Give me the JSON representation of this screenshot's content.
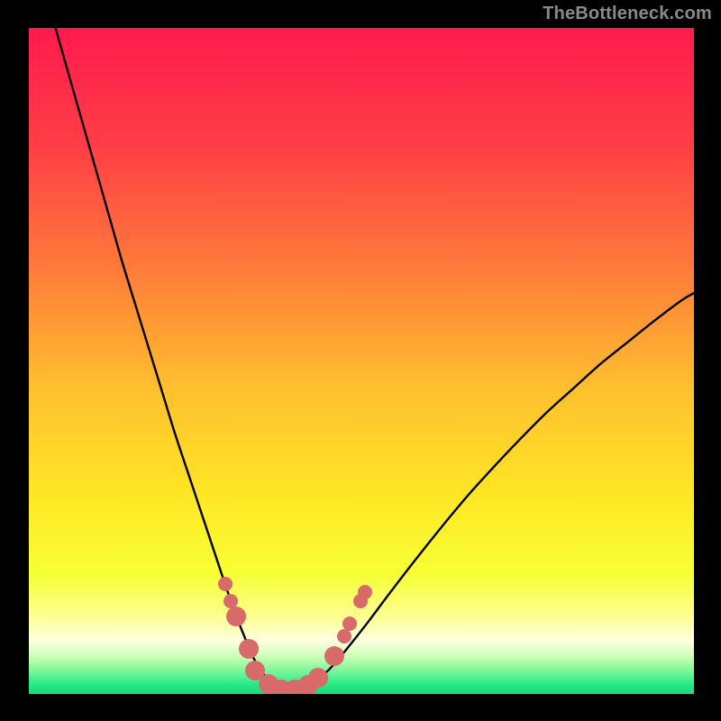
{
  "watermark": {
    "text": "TheBottleneck.com"
  },
  "chart_data": {
    "type": "line",
    "title": "",
    "xlabel": "",
    "ylabel": "",
    "xlim": [
      0,
      100
    ],
    "ylim": [
      0,
      100
    ],
    "grid": false,
    "legend": false,
    "background_gradient": {
      "orientation": "vertical",
      "stops": [
        {
          "pos": 0.0,
          "color": "#ff1a4e"
        },
        {
          "pos": 0.18,
          "color": "#ff3f46"
        },
        {
          "pos": 0.36,
          "color": "#ff7a3a"
        },
        {
          "pos": 0.54,
          "color": "#ffbf2e"
        },
        {
          "pos": 0.7,
          "color": "#ffe625"
        },
        {
          "pos": 0.82,
          "color": "#f6ff35"
        },
        {
          "pos": 0.88,
          "color": "#fdff8a"
        },
        {
          "pos": 0.92,
          "color": "#ffffe0"
        },
        {
          "pos": 0.945,
          "color": "#c7ffb3"
        },
        {
          "pos": 0.965,
          "color": "#7ef79a"
        },
        {
          "pos": 0.985,
          "color": "#2bea87"
        },
        {
          "pos": 1.0,
          "color": "#16d97a"
        }
      ]
    },
    "series": [
      {
        "name": "bottleneck-curve",
        "color": "#000000",
        "stroke_width": 2.4,
        "x": [
          4,
          6,
          8,
          10,
          12,
          14,
          16,
          18,
          20,
          22,
          24,
          26,
          28,
          29.5,
          31,
          32.5,
          34,
          36,
          38,
          40,
          42,
          44,
          46,
          48,
          51,
          54,
          58,
          62,
          66,
          70,
          74,
          78,
          82,
          86,
          90,
          94,
          98,
          100
        ],
        "y": [
          100,
          93,
          86,
          79,
          72,
          65,
          58.5,
          52,
          45.5,
          39,
          33,
          27,
          21,
          16.5,
          12.2,
          8.4,
          5,
          2.1,
          0.7,
          0.6,
          1.2,
          2.6,
          4.6,
          7.0,
          10.8,
          14.8,
          20.0,
          25.0,
          29.8,
          34.2,
          38.4,
          42.4,
          46.0,
          49.6,
          52.8,
          56.0,
          59.0,
          60.2
        ]
      }
    ],
    "markers": {
      "color": "#d86a6a",
      "radius_primary": 11,
      "radius_secondary": 8,
      "points": [
        {
          "x": 29.5,
          "y": 16.5,
          "r": "secondary"
        },
        {
          "x": 30.3,
          "y": 14.0,
          "r": "secondary"
        },
        {
          "x": 31.2,
          "y": 11.7,
          "r": "primary"
        },
        {
          "x": 33.0,
          "y": 6.8,
          "r": "primary"
        },
        {
          "x": 34.0,
          "y": 3.5,
          "r": "primary"
        },
        {
          "x": 36.0,
          "y": 1.5,
          "r": "primary"
        },
        {
          "x": 38.0,
          "y": 0.7,
          "r": "primary"
        },
        {
          "x": 40.0,
          "y": 0.7,
          "r": "primary"
        },
        {
          "x": 42.0,
          "y": 1.3,
          "r": "primary"
        },
        {
          "x": 43.5,
          "y": 2.5,
          "r": "primary"
        },
        {
          "x": 46.0,
          "y": 5.7,
          "r": "primary"
        },
        {
          "x": 47.4,
          "y": 8.6,
          "r": "secondary"
        },
        {
          "x": 48.2,
          "y": 10.5,
          "r": "secondary"
        },
        {
          "x": 49.9,
          "y": 14.0,
          "r": "secondary"
        },
        {
          "x": 50.5,
          "y": 15.3,
          "r": "secondary"
        }
      ]
    }
  }
}
